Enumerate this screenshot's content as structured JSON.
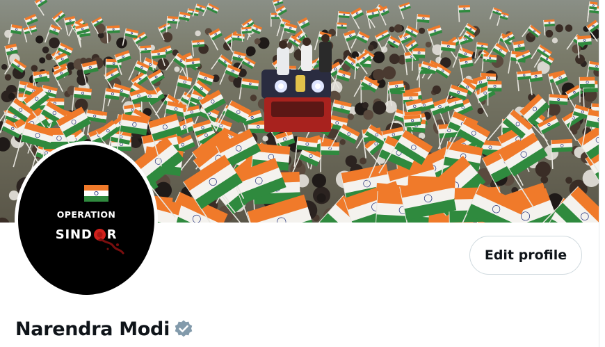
{
  "profile": {
    "display_name": "Narendra Modi",
    "verified_badge_icon": "verified-badge-icon",
    "verified_color": "#829aab"
  },
  "avatar": {
    "line1": "OPERATION",
    "line2_before": "SIND",
    "line2_after": "R",
    "flag_icon": "india-flag-icon",
    "accent": "#d0201c"
  },
  "banner": {
    "subject": "crowd-with-flags-photo"
  },
  "actions": {
    "edit_profile_label": "Edit profile"
  },
  "colors": {
    "saffron": "#f07a2a",
    "flag_white": "#f4f2ee",
    "flag_green": "#2f8a3e",
    "chakra": "#23307a"
  }
}
